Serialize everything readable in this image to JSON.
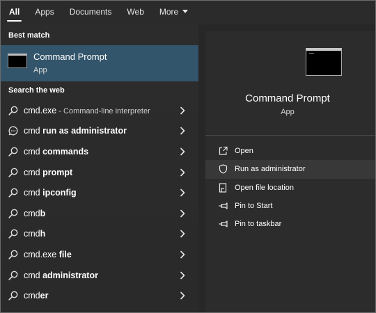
{
  "tabs": [
    {
      "label": "All",
      "active": true
    },
    {
      "label": "Apps",
      "active": false
    },
    {
      "label": "Documents",
      "active": false
    },
    {
      "label": "Web",
      "active": false
    },
    {
      "label": "More",
      "active": false,
      "dropdown": true
    }
  ],
  "best_match": {
    "heading": "Best match",
    "name": "Command Prompt",
    "kind": "App",
    "icon": "command-prompt-icon"
  },
  "web": {
    "heading": "Search the web",
    "items": [
      {
        "prefix": "cmd.exe",
        "bold": "",
        "sub": " - Command-line interpreter",
        "icon": "search-icon"
      },
      {
        "prefix": "cmd ",
        "bold": "run as administrator",
        "sub": "",
        "icon": "chat-icon"
      },
      {
        "prefix": "cmd ",
        "bold": "commands",
        "sub": "",
        "icon": "search-icon"
      },
      {
        "prefix": "cmd ",
        "bold": "prompt",
        "sub": "",
        "icon": "search-icon"
      },
      {
        "prefix": "cmd ",
        "bold": "ipconfig",
        "sub": "",
        "icon": "search-icon"
      },
      {
        "prefix": "cmd",
        "bold": "b",
        "sub": "",
        "icon": "search-icon"
      },
      {
        "prefix": "cmd",
        "bold": "h",
        "sub": "",
        "icon": "search-icon"
      },
      {
        "prefix": "cmd.exe ",
        "bold": "file",
        "sub": "",
        "icon": "search-icon"
      },
      {
        "prefix": "cmd ",
        "bold": "administrator",
        "sub": "",
        "icon": "search-icon"
      },
      {
        "prefix": "cmd",
        "bold": "er",
        "sub": "",
        "icon": "search-icon"
      }
    ]
  },
  "preview": {
    "title": "Command Prompt",
    "kind": "App",
    "icon": "command-prompt-icon",
    "actions": [
      {
        "label": "Open",
        "icon": "open-icon",
        "highlighted": false
      },
      {
        "label": "Run as administrator",
        "icon": "shield-icon",
        "highlighted": true
      },
      {
        "label": "Open file location",
        "icon": "file-location-icon",
        "highlighted": false
      },
      {
        "label": "Pin to Start",
        "icon": "pin-icon",
        "highlighted": false
      },
      {
        "label": "Pin to taskbar",
        "icon": "pin-icon",
        "highlighted": false
      }
    ]
  },
  "colors": {
    "selected_bg": "#33556b",
    "pane_bg": "#2c2c2c",
    "hover_bg": "#383838"
  }
}
